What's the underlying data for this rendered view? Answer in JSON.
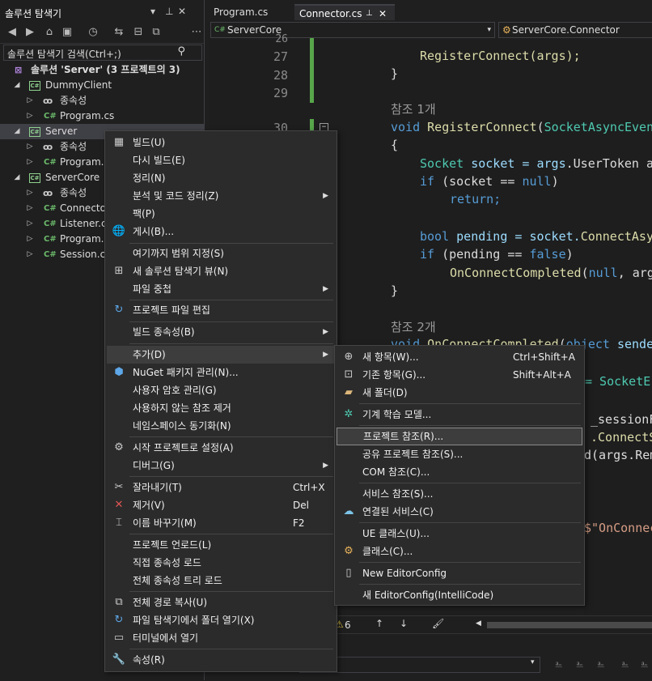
{
  "solution_explorer": {
    "title": "솔루션 탐색기",
    "search_placeholder": "솔루션 탐색기 검색(Ctrl+;)",
    "tree": [
      {
        "label": "솔루션 'Server'  (3 프로젝트의 3)",
        "icon": "solution-icon"
      },
      {
        "label": "DummyClient",
        "icon": "csharp-project-icon"
      },
      {
        "label": "종속성",
        "icon": "dependencies-icon"
      },
      {
        "label": "Program.cs",
        "icon": "csharp-file-icon"
      },
      {
        "label": "Server",
        "icon": "csharp-project-icon"
      },
      {
        "label": "종속성",
        "icon": "dependencies-icon"
      },
      {
        "label": "Program.c",
        "icon": "csharp-file-icon"
      },
      {
        "label": "ServerCore",
        "icon": "csharp-project-icon"
      },
      {
        "label": "종속성",
        "icon": "dependencies-icon"
      },
      {
        "label": "Connector",
        "icon": "csharp-file-icon"
      },
      {
        "label": "Listener.cs",
        "icon": "csharp-file-icon"
      },
      {
        "label": "Program.c",
        "icon": "csharp-file-icon"
      },
      {
        "label": "Session.cs",
        "icon": "csharp-file-icon"
      }
    ]
  },
  "editor": {
    "tabs": [
      {
        "label": "Program.cs",
        "active": false
      },
      {
        "label": "Connector.cs",
        "active": true
      }
    ],
    "nav_project": "ServerCore",
    "nav_class": "ServerCore.Connector",
    "line_numbers": [
      "26",
      "27",
      "28",
      "29",
      "30"
    ],
    "code": {
      "l27": "RegisterConnect(args);",
      "l28": "}",
      "ref1": "참조 1개",
      "l30a": "void ",
      "l30b": "RegisterConnect",
      "l30c": "(",
      "l30d": "SocketAsyncEven",
      "brace_open": "{",
      "socket_a": "Socket",
      "socket_b": " socket = ",
      "socket_c": "args",
      "socket_d": ".UserToken a",
      "if1_a": "if",
      "if1_b": " (socket == ",
      "if1_c": "null",
      "if1_d": ")",
      "ret": "return;",
      "bool_a": "bool",
      "bool_b": " pending = socket.",
      "bool_c": "ConnectAsy",
      "if2_a": "if",
      "if2_b": " (pending == ",
      "if2_c": "false",
      "if2_d": ")",
      "occ_a": "OnConnectCompleted",
      "occ_b": "(",
      "occ_c": "null",
      "occ_d": ", arg",
      "brace_close": "}",
      "ref2": "참조 2개",
      "l_void2a": "void ",
      "l_void2b": "OnConnectCompleted",
      "l_void2c": "(",
      "l_void2d": "object",
      "l_void2e": " sende",
      "frag1": "= SocketE",
      "frag2": "_sessionFa",
      "frag3": ".ConnectS",
      "frag4": "d(args.Rem",
      "frag5": "$\"OnConnec"
    },
    "bottom_bar": {
      "error_count": "6"
    }
  },
  "context_menu": {
    "items": [
      {
        "label": "빌드(U)",
        "icon": "build-icon"
      },
      {
        "label": "다시 빌드(E)"
      },
      {
        "label": "정리(N)"
      },
      {
        "label": "분석 및 코드 정리(Z)",
        "submenu": true
      },
      {
        "label": "팩(P)"
      },
      {
        "label": "게시(B)...",
        "icon": "globe-icon"
      },
      {
        "label": "여기까지 범위 지정(S)"
      },
      {
        "label": "새 솔루션 탐색기 뷰(N)",
        "icon": "new-view-icon"
      },
      {
        "label": "파일 중첩",
        "submenu": true
      },
      {
        "label": "프로젝트 파일 편집",
        "icon": "edit-project-icon"
      },
      {
        "label": "빌드 종속성(B)",
        "submenu": true
      },
      {
        "label": "추가(D)",
        "submenu": true
      },
      {
        "label": "NuGet 패키지 관리(N)...",
        "icon": "nuget-icon"
      },
      {
        "label": "사용자 암호 관리(G)"
      },
      {
        "label": "사용하지 않는 참조 제거"
      },
      {
        "label": "네임스페이스 동기화(N)"
      },
      {
        "label": "시작 프로젝트로 설정(A)",
        "icon": "settings-icon"
      },
      {
        "label": "디버그(G)",
        "submenu": true
      },
      {
        "label": "잘라내기(T)",
        "shortcut": "Ctrl+X",
        "icon": "cut-icon"
      },
      {
        "label": "제거(V)",
        "shortcut": "Del",
        "icon": "remove-icon"
      },
      {
        "label": "이름 바꾸기(M)",
        "shortcut": "F2",
        "icon": "rename-icon"
      },
      {
        "label": "프로젝트 언로드(L)"
      },
      {
        "label": "직접 종속성 로드"
      },
      {
        "label": "전체 종속성 트리 로드"
      },
      {
        "label": "전체 경로 복사(U)",
        "icon": "copy-icon"
      },
      {
        "label": "파일 탐색기에서 폴더 열기(X)",
        "icon": "refresh-icon"
      },
      {
        "label": "터미널에서 열기",
        "icon": "terminal-icon"
      },
      {
        "label": "속성(R)",
        "icon": "wrench-icon"
      }
    ]
  },
  "add_submenu": {
    "items": [
      {
        "label": "새 항목(W)...",
        "shortcut": "Ctrl+Shift+A",
        "icon": "new-item-icon"
      },
      {
        "label": "기존 항목(G)...",
        "shortcut": "Shift+Alt+A",
        "icon": "existing-item-icon"
      },
      {
        "label": "새 폴더(D)",
        "icon": "new-folder-icon"
      },
      {
        "label": "기계 학습 모델...",
        "icon": "ml-model-icon"
      },
      {
        "label": "프로젝트 참조(R)..."
      },
      {
        "label": "공유 프로젝트 참조(S)..."
      },
      {
        "label": "COM 참조(C)..."
      },
      {
        "label": "서비스 참조(S)..."
      },
      {
        "label": "연결된 서비스(C)",
        "icon": "connected-service-icon"
      },
      {
        "label": "UE 클래스(U)..."
      },
      {
        "label": "클래스(C)...",
        "icon": "class-icon"
      },
      {
        "label": "New EditorConfig",
        "icon": "file-icon"
      },
      {
        "label": "새 EditorConfig(IntelliCode)"
      }
    ]
  },
  "colors": {
    "accent": "#3f3f46",
    "green_bar": "#57a64a",
    "keyword": "#569cd6",
    "type": "#4ec9b0"
  }
}
